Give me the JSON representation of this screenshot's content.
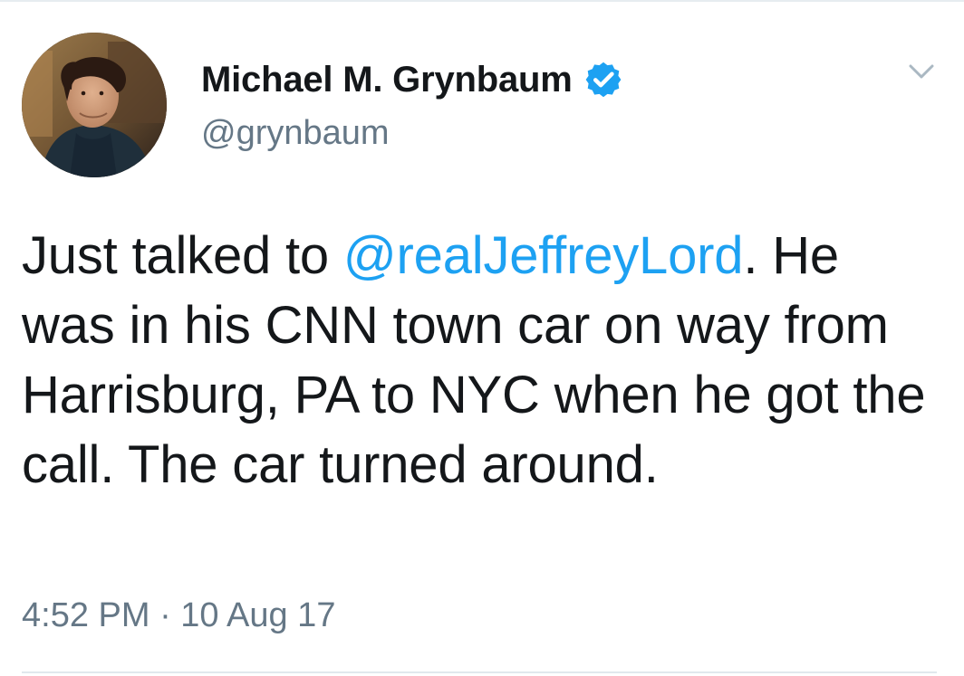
{
  "author": {
    "display_name": "Michael M. Grynbaum",
    "username": "@grynbaum",
    "verified": true,
    "avatar_icon": "profile-photo"
  },
  "tweet": {
    "text_before_mention": "Just talked to ",
    "mention": "@realJeffreyLord",
    "text_after_mention": ". He was in his CNN town car on way from Harrisburg, PA to NYC when he got the call. The car turned around.",
    "timestamp": "4:52 PM · 10 Aug 17"
  },
  "icons": {
    "verified": "verified-badge-icon",
    "menu": "chevron-down-icon"
  },
  "colors": {
    "text": "#14171a",
    "secondary_text": "#657786",
    "mention": "#1da1f2",
    "verified": "#1da1f2",
    "divider": "#e1e8ed"
  }
}
